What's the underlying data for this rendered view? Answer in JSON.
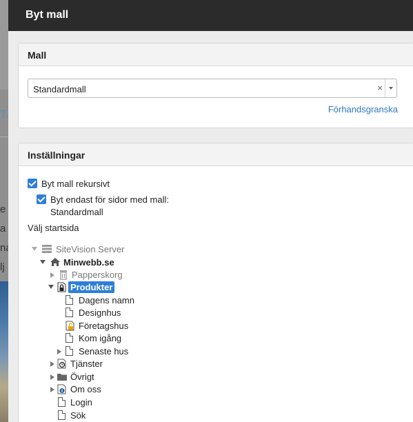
{
  "background": {
    "link_fragment": "TJ",
    "chars": [
      "e",
      "a",
      "na",
      "lj"
    ]
  },
  "modal": {
    "title": "Byt mall"
  },
  "mall_panel": {
    "heading": "Mall",
    "select_value": "Standardmall",
    "clear_symbol": "×",
    "preview_label": "Förhandsgranska"
  },
  "settings_panel": {
    "heading": "Inställningar",
    "recursive_label": "Byt mall rekursivt",
    "only_label_line1": "Byt endast för sidor med mall:",
    "only_label_line2": "Standardmall",
    "start_label": "Välj startsida"
  },
  "tree": [
    {
      "label": "SiteVision Server",
      "icon": "server-icon",
      "expander": "down-gray",
      "muted": true
    },
    {
      "label": "Minwebb.se",
      "icon": "home-icon",
      "expander": "down",
      "bold": true
    },
    {
      "label": "Papperskorg",
      "icon": "trash-icon",
      "expander": "right",
      "muted": true
    },
    {
      "label": "Produkter",
      "icon": "locked-page-icon",
      "expander": "down",
      "selected": true
    },
    {
      "label": "Dagens namn",
      "icon": "page-icon"
    },
    {
      "label": "Designhus",
      "icon": "page-icon"
    },
    {
      "label": "Företagshus",
      "icon": "unlocked-page-icon"
    },
    {
      "label": "Kom igång",
      "icon": "page-icon"
    },
    {
      "label": "Senaste hus",
      "icon": "page-icon",
      "expander": "right"
    },
    {
      "label": "Tjänster",
      "icon": "clock-page-icon",
      "expander": "right"
    },
    {
      "label": "Övrigt",
      "icon": "folder-icon",
      "expander": "right"
    },
    {
      "label": "Om oss",
      "icon": "info-page-icon",
      "expander": "right"
    },
    {
      "label": "Login",
      "icon": "page-icon"
    },
    {
      "label": "Sök",
      "icon": "page-icon"
    }
  ]
}
